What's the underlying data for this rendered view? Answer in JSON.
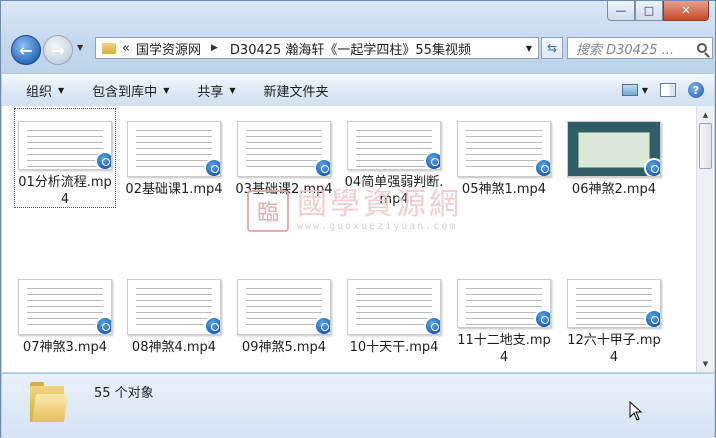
{
  "window": {
    "caption_buttons": [
      "minimize",
      "maximize",
      "close"
    ]
  },
  "nav": {
    "address_overflow": "«",
    "address_segments": [
      "国学资源网",
      "D30425 瀚海轩《一起学四柱》55集视频"
    ],
    "search_placeholder": "搜索 D30425 ..."
  },
  "toolbar": {
    "organize": "组织",
    "include_library": "包含到库中",
    "share": "共享",
    "new_folder": "新建文件夹"
  },
  "files": [
    {
      "name": "01分析流程.mp4",
      "selected": true
    },
    {
      "name": "02基础课1.mp4"
    },
    {
      "name": "03基础课2.mp4"
    },
    {
      "name": "04简单强弱判断.mp4"
    },
    {
      "name": "05神煞1.mp4"
    },
    {
      "name": "06神煞2.mp4"
    },
    {
      "name": "07神煞3.mp4"
    },
    {
      "name": "08神煞4.mp4"
    },
    {
      "name": "09神煞5.mp4"
    },
    {
      "name": "10十天干.mp4"
    },
    {
      "name": "11十二地支.mp4"
    },
    {
      "name": "12六十甲子.mp4"
    }
  ],
  "watermark": {
    "seal": "臨",
    "text": "國學資源網",
    "url": "www.guoxueziyuan.com"
  },
  "status": {
    "count": "55 个对象"
  },
  "colors": {
    "media_badge": "#1659ae",
    "chrome": "#c6d9ee",
    "close_button": "#c74a2e"
  }
}
